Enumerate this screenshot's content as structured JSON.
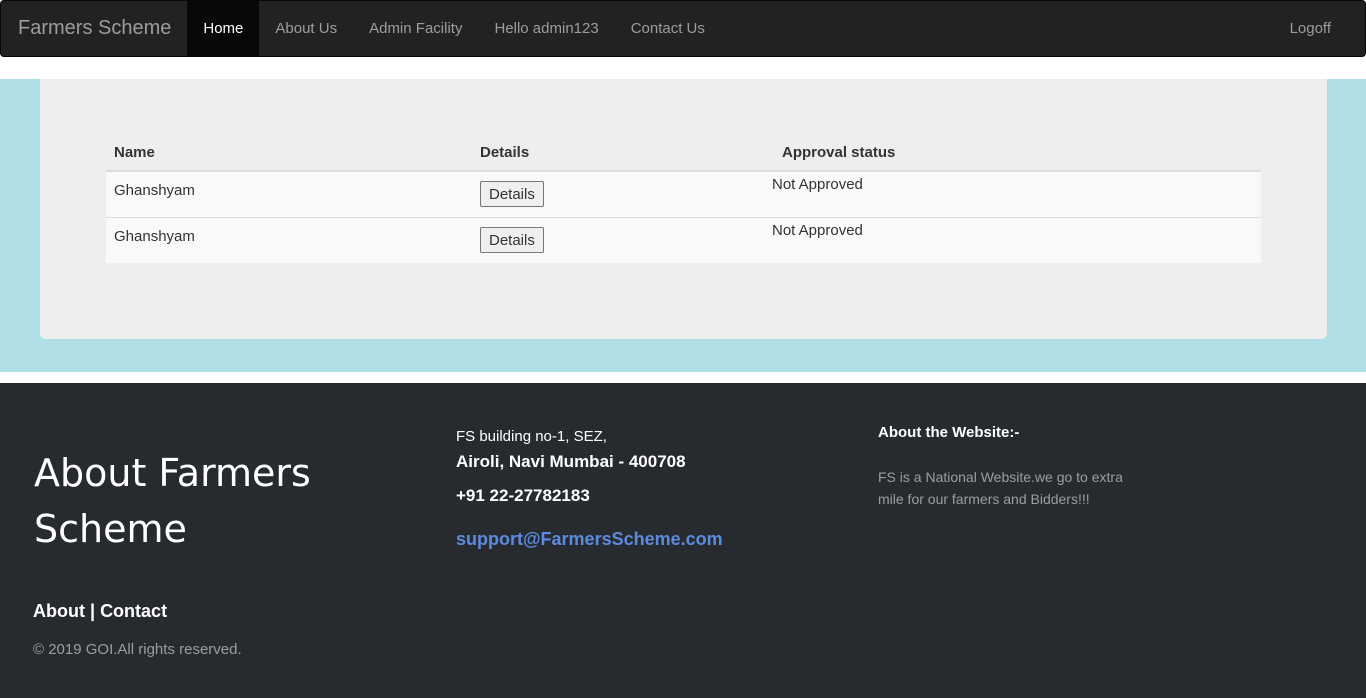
{
  "navbar": {
    "brand": "Farmers Scheme",
    "items": [
      {
        "label": "Home",
        "active": true
      },
      {
        "label": "About Us",
        "active": false
      },
      {
        "label": "Admin Facility",
        "active": false
      },
      {
        "label": "Hello admin123",
        "active": false
      },
      {
        "label": "Contact Us",
        "active": false
      }
    ],
    "logoff": "Logoff"
  },
  "table": {
    "headers": [
      "Name",
      "Details",
      "Approval status"
    ],
    "rows": [
      {
        "name": "Ghanshyam",
        "details_button": "Details",
        "status": "Not Approved"
      },
      {
        "name": "Ghanshyam",
        "details_button": "Details",
        "status": "Not Approved"
      }
    ]
  },
  "footer": {
    "title": "About Farmers Scheme",
    "links": {
      "about": "About",
      "separator": "|",
      "contact": "Contact"
    },
    "copyright": "© 2019 GOI.All rights reserved.",
    "address_line1": "FS building no-1, SEZ,",
    "address_line2": "Airoli, Navi Mumbai - 400708",
    "phone": "+91 22-27782183",
    "email": "support@FarmersScheme.com",
    "about_heading": "About the Website:-",
    "about_text": "FS is a National Website.we go to extra mile for our farmers and Bidders!!!"
  },
  "colors": {
    "navbar_bg": "#222222",
    "band_bg": "#b0e0e6",
    "panel_bg": "#eeeeee",
    "footer_bg": "#272b2f",
    "email_link": "#5b8bdf"
  }
}
